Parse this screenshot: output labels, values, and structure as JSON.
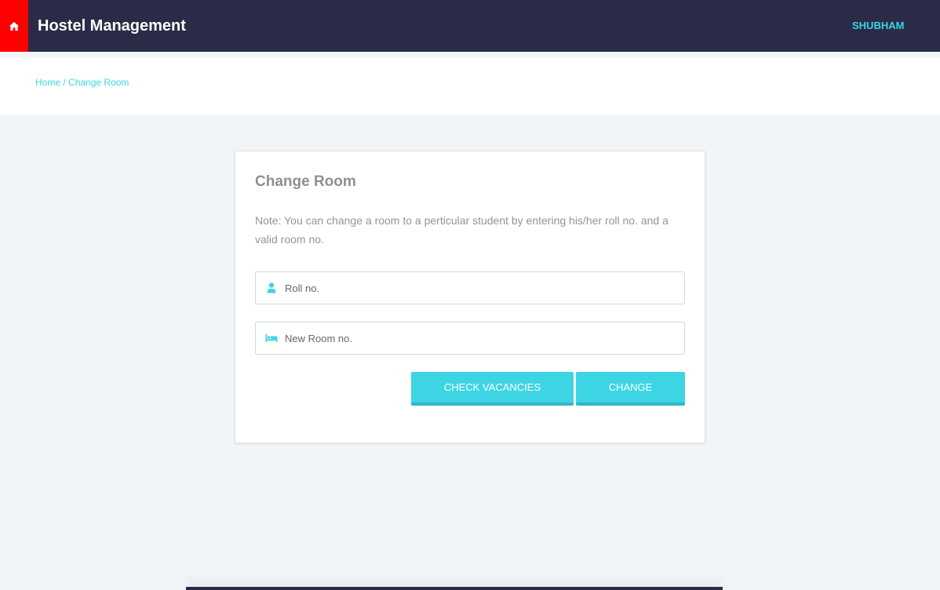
{
  "navbar": {
    "title": "Hostel Management",
    "user": "SHUBHAM",
    "home_icon": "home-icon"
  },
  "breadcrumb": {
    "home": "Home",
    "separator": "/",
    "current": "Change Room"
  },
  "form": {
    "title": "Change Room",
    "note": "Note: You can change a room to a perticular student by entering his/her roll no. and a valid room no.",
    "roll_placeholder": "Roll no.",
    "room_placeholder": "New Room no.",
    "roll_icon": "user-icon",
    "room_icon": "bed-icon",
    "check_label": "CHECK VACANCIES",
    "change_label": "CHANGE"
  },
  "colors": {
    "navbar": "#2a2c47",
    "home_button": "#ff0000",
    "accent": "#3dd5e4",
    "page_bg": "#f2f5f8"
  }
}
